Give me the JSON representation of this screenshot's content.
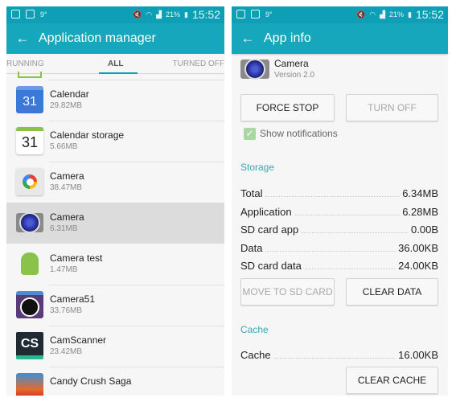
{
  "status_bar": {
    "left_icons": [
      "instagram-icon",
      "gallery-icon",
      "temperature-icon"
    ],
    "temperature": "9°",
    "battery_percent": "21%",
    "time": "15:52"
  },
  "left_screen": {
    "title": "Application manager",
    "tabs": [
      {
        "label": "RUNNING",
        "active": false
      },
      {
        "label": "ALL",
        "active": true
      },
      {
        "label": "TURNED OFF",
        "active": false
      }
    ],
    "apps": [
      {
        "name": "Calendar",
        "size": "29.82MB",
        "icon": "google-calendar-icon",
        "selected": false
      },
      {
        "name": "Calendar storage",
        "size": "5.66MB",
        "icon": "calendar-storage-icon",
        "selected": false
      },
      {
        "name": "Camera",
        "size": "38.47MB",
        "icon": "google-camera-icon",
        "selected": false
      },
      {
        "name": "Camera",
        "size": "6.31MB",
        "icon": "samsung-camera-icon",
        "selected": true
      },
      {
        "name": "Camera test",
        "size": "1.47MB",
        "icon": "android-icon",
        "selected": false
      },
      {
        "name": "Camera51",
        "size": "33.76MB",
        "icon": "camera51-icon",
        "selected": false
      },
      {
        "name": "CamScanner",
        "size": "23.42MB",
        "icon": "camscanner-icon",
        "selected": false
      },
      {
        "name": "Candy Crush Saga",
        "size": "",
        "icon": "candy-crush-icon",
        "selected": false
      }
    ],
    "calendar_day": "31",
    "camscanner_text": "CS"
  },
  "right_screen": {
    "title": "App info",
    "app_name": "Camera",
    "version": "Version 2.0",
    "force_stop": "FORCE STOP",
    "turn_off": "TURN OFF",
    "show_notifications": "Show notifications",
    "show_notifications_checked": true,
    "storage_header": "Storage",
    "storage": [
      {
        "label": "Total",
        "value": "6.34MB"
      },
      {
        "label": "Application",
        "value": "6.28MB"
      },
      {
        "label": "SD card app",
        "value": "0.00B"
      },
      {
        "label": "Data",
        "value": "36.00KB"
      },
      {
        "label": "SD card data",
        "value": "24.00KB"
      }
    ],
    "move_to_sd": "MOVE TO SD CARD",
    "clear_data": "CLEAR DATA",
    "cache_header": "Cache",
    "cache": {
      "label": "Cache",
      "value": "16.00KB"
    },
    "clear_cache": "CLEAR CACHE"
  },
  "colors": {
    "primary": "#16a7bd",
    "status_bar": "#0d9fb5",
    "accent_text": "#3aa7b4"
  }
}
